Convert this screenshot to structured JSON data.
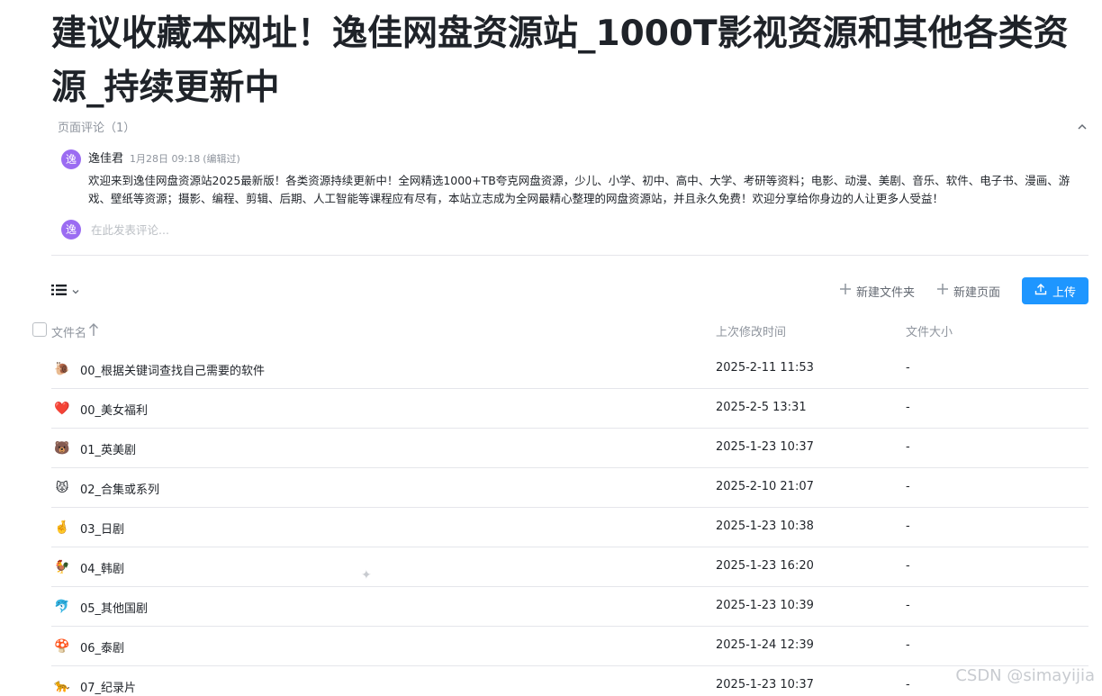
{
  "page": {
    "title": "建议收藏本网址！逸佳网盘资源站_1000T影视资源和其他各类资源_持续更新中"
  },
  "comments": {
    "header": "页面评论（1）",
    "items": [
      {
        "avatar_char": "逸",
        "author": "逸佳君",
        "time": "1月28日 09:18",
        "edited": "(编辑过)",
        "body": "欢迎来到逸佳网盘资源站2025最新版！各类资源持续更新中！全网精选1000+TB夸克网盘资源，少儿、小学、初中、高中、大学、考研等资料；电影、动漫、美剧、音乐、软件、电子书、漫画、游戏、壁纸等资源；摄影、编程、剪辑、后期、人工智能等课程应有尽有，本站立志成为全网最精心整理的网盘资源站，并且永久免费！欢迎分享给你身边的人让更多人受益！"
      }
    ],
    "reply_avatar_char": "逸",
    "reply_placeholder": "在此发表评论..."
  },
  "toolbar": {
    "new_folder": "新建文件夹",
    "new_page": "新建页面",
    "upload": "上传",
    "accent": "#1e96ff"
  },
  "table": {
    "columns": {
      "name": "文件名",
      "modified": "上次修改时间",
      "size": "文件大小"
    },
    "rows": [
      {
        "icon": "snail-icon",
        "emoji": "🐌",
        "name": "00_根据关键词查找自己需要的软件",
        "modified": "2025-2-11 11:53",
        "size": "-"
      },
      {
        "icon": "heart-icon",
        "emoji": "❤️",
        "name": "00_美女福利",
        "modified": "2025-2-5 13:31",
        "size": "-"
      },
      {
        "icon": "bear-icon",
        "emoji": "🐻",
        "name": "01_英美剧",
        "modified": "2025-1-23 10:37",
        "size": "-"
      },
      {
        "icon": "cat-icon",
        "emoji": "😾",
        "name": "02_合集或系列",
        "modified": "2025-2-10 21:07",
        "size": "-"
      },
      {
        "icon": "crossed-fingers-icon",
        "emoji": "🤞",
        "name": "03_日剧",
        "modified": "2025-1-23 10:38",
        "size": "-"
      },
      {
        "icon": "rooster-icon",
        "emoji": "🐓",
        "name": "04_韩剧",
        "modified": "2025-1-23 16:20",
        "size": "-"
      },
      {
        "icon": "dolphin-icon",
        "emoji": "🐬",
        "name": "05_其他国剧",
        "modified": "2025-1-23 10:39",
        "size": "-"
      },
      {
        "icon": "mushroom-icon",
        "emoji": "🍄",
        "name": "06_泰剧",
        "modified": "2025-1-24 12:39",
        "size": "-"
      },
      {
        "icon": "leopard-icon",
        "emoji": "🐆",
        "name": "07_纪录片",
        "modified": "2025-1-23 10:37",
        "size": "-"
      }
    ]
  },
  "watermark": "CSDN @simayijia"
}
